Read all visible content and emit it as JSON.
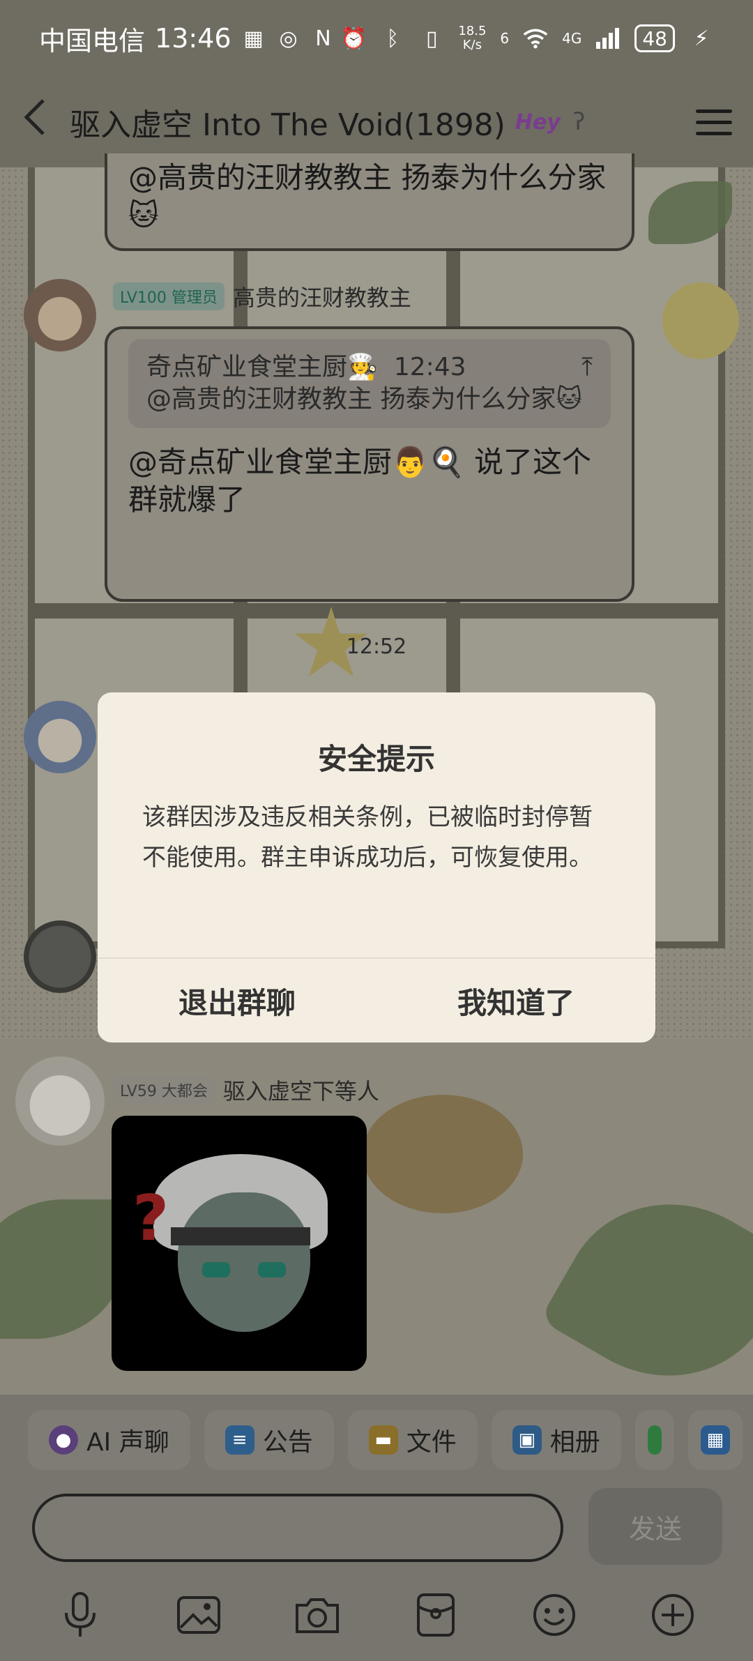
{
  "status_bar": {
    "carrier": "中国电信",
    "time": "13:46",
    "net_speed_value": "18.5",
    "net_speed_unit": "K/s",
    "network_type": "4G",
    "sim_label": "6",
    "battery": "48"
  },
  "header": {
    "title": "驱入虚空 Into The Void(1898)",
    "title_badge": "Hey",
    "back_icon": "chevron-left-icon",
    "menu_icon": "hamburger-menu-icon"
  },
  "chat": {
    "msg1_text": "@高贵的汪财教教主 扬泰为什么分家🐱",
    "msg2_sender_level": "LV100 管理员",
    "msg2_sender_name": "高贵的汪财教教主",
    "msg2_quote_author": "奇点矿业食堂主厨🧑‍🍳",
    "msg2_quote_time": "12:43",
    "msg2_quote_text": "@高贵的汪财教教主 扬泰为什么分家🐱",
    "msg2_text": "@奇点矿业食堂主厨👨🍳 说了这个群就爆了",
    "timestamp": "12:52",
    "msg3_sender_level": "LV59 大都会",
    "msg3_sender_name": "驱入虚空下等人"
  },
  "dialog": {
    "title": "安全提示",
    "body": "该群因涉及违反相关条例，已被临时封停暂不能使用。群主申诉成功后，可恢复使用。",
    "exit_label": "退出群聊",
    "ok_label": "我知道了"
  },
  "toolbar": {
    "chips": [
      {
        "label": "AI 声聊",
        "icon": "ai-voice-icon"
      },
      {
        "label": "公告",
        "icon": "notice-icon"
      },
      {
        "label": "文件",
        "icon": "folder-icon"
      },
      {
        "label": "相册",
        "icon": "album-icon"
      }
    ]
  },
  "input": {
    "placeholder": "",
    "send_label": "发送"
  },
  "bottom_icons": [
    "microphone-icon",
    "image-icon",
    "camera-icon",
    "red-packet-icon",
    "emoji-icon",
    "plus-icon"
  ]
}
